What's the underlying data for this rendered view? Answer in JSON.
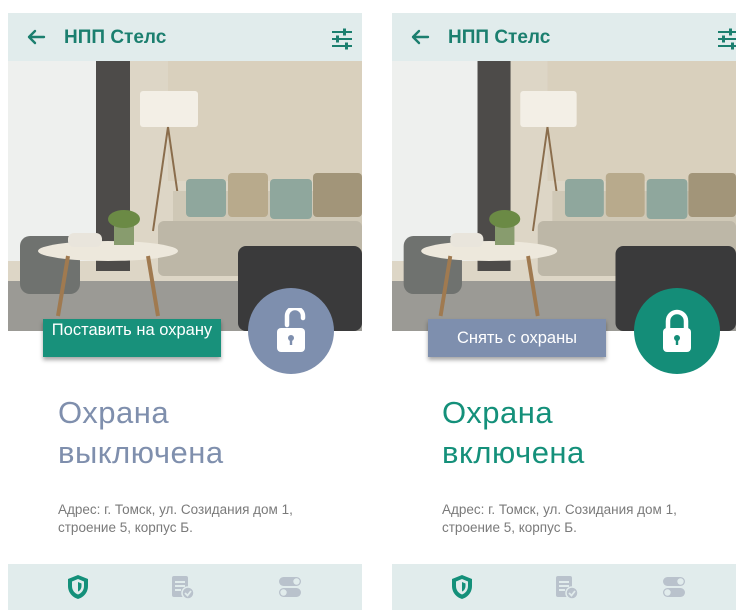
{
  "colors": {
    "primary": "#18917b",
    "disarmed": "#7e8fae",
    "appbar": "#e1ecec"
  },
  "screens": [
    {
      "app_title": "НПП Стелс",
      "action_label": "Поставить на охрану",
      "lock_state": "unlocked",
      "status_line1": "Охрана",
      "status_line2": "выключена",
      "address_line1": "Адрес: г. Томск, ул. Созидания дом 1,",
      "address_line2": "строение 5, корпус Б.",
      "icons": [
        "back-arrow-icon",
        "filter-sliders-icon",
        "unlocked-padlock-icon",
        "shield-icon",
        "checklist-icon",
        "toggles-icon"
      ]
    },
    {
      "app_title": "НПП Стелс",
      "action_label": "Снять с охраны",
      "lock_state": "locked",
      "status_line1": "Охрана",
      "status_line2": "включена",
      "address_line1": "Адрес: г. Томск, ул. Созидания дом 1,",
      "address_line2": "строение 5, корпус Б.",
      "icons": [
        "back-arrow-icon",
        "filter-sliders-icon",
        "locked-padlock-icon",
        "shield-icon",
        "checklist-icon",
        "toggles-icon"
      ]
    }
  ]
}
